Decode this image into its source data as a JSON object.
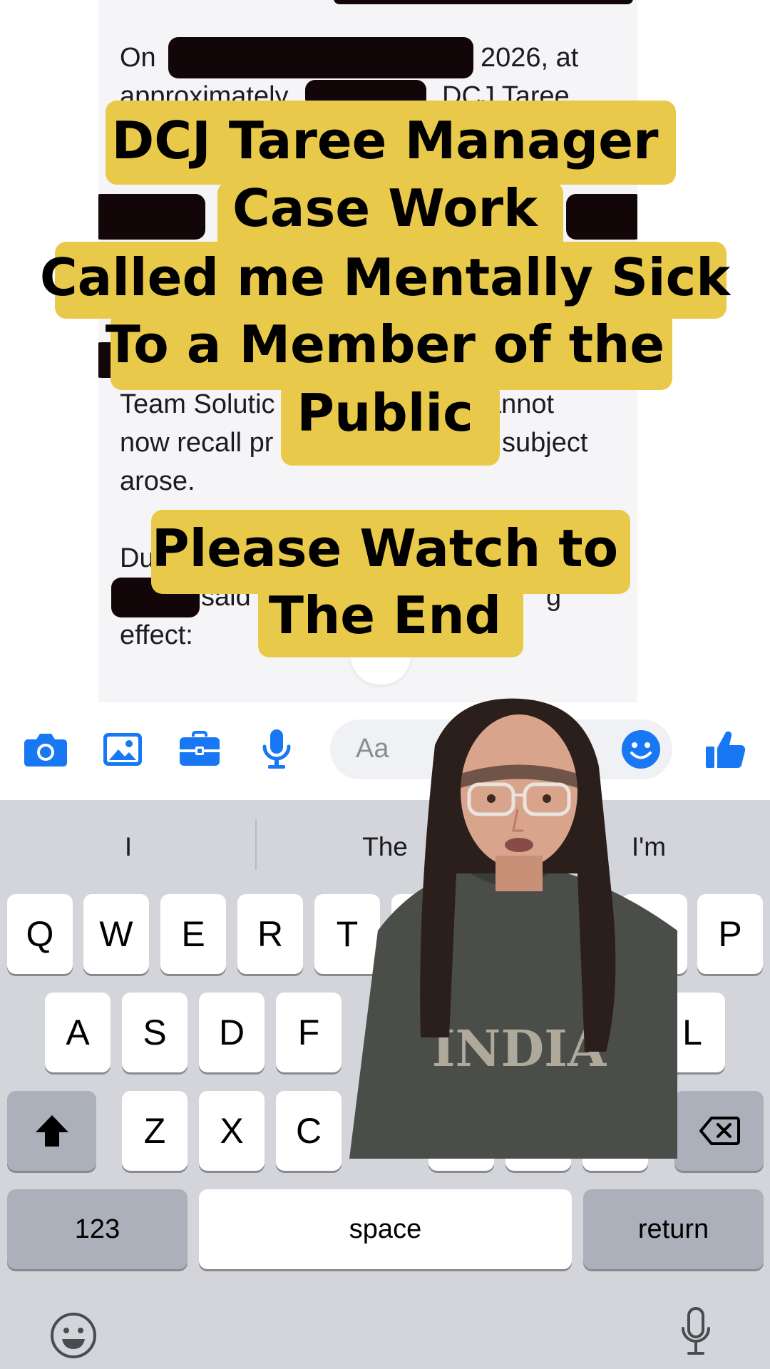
{
  "document": {
    "line1_start": "On",
    "line1_end": "2026, at",
    "line2_start": "approximately",
    "line2_end": "DCJ Taree",
    "team_line_start": "Team Solutic",
    "team_line_end": "annot",
    "recall_start": "now recall pr",
    "recall_end": "subject",
    "arose": "arose.",
    "during": "Du",
    "said": "said",
    "said_end": "g",
    "effect": "effect:"
  },
  "captions": {
    "top": [
      "DCJ Taree Manager",
      "Case Work",
      "Called me Mentally Sick",
      "To a Member of the",
      "Public"
    ],
    "bottom": [
      "Please Watch to",
      "The End"
    ]
  },
  "composer": {
    "placeholder": "Aa",
    "icons": [
      "camera-icon",
      "image-icon",
      "briefcase-icon",
      "microphone-icon",
      "emoji-icon",
      "thumbs-up-icon"
    ],
    "accent_color": "#1877f2"
  },
  "keyboard": {
    "suggestions": [
      "I",
      "The",
      "I'm"
    ],
    "row1": [
      "Q",
      "W",
      "E",
      "R",
      "T",
      "P"
    ],
    "row2": [
      "A",
      "S",
      "D",
      "F",
      "L"
    ],
    "row3": [
      "Z",
      "X",
      "C"
    ],
    "numbers_label": "123",
    "space_label": "space",
    "return_label": "return"
  }
}
